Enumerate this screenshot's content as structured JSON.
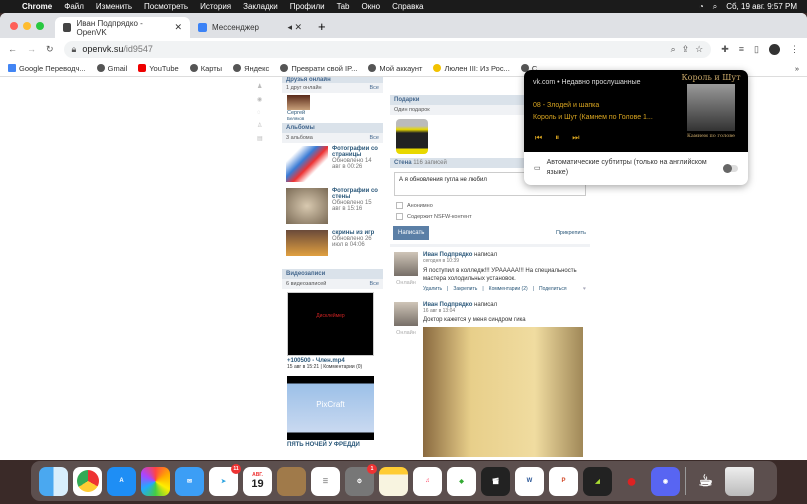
{
  "menubar": {
    "app": "Chrome",
    "items": [
      "Файл",
      "Изменить",
      "Посмотреть",
      "История",
      "Закладки",
      "Профили",
      "Tab",
      "Окно",
      "Справка"
    ],
    "clock": "Сб, 19 авг. 9:57 PM"
  },
  "tabs": [
    {
      "title": "Иван Подпрядко - OpenVK"
    },
    {
      "title": "Мессенджер"
    }
  ],
  "address": {
    "host": "openvk.su",
    "path": "/id9547"
  },
  "bookmarks": [
    "Google Переводч...",
    "Gmail",
    "YouTube",
    "Карты",
    "Яндекс",
    "Преврати свой IP...",
    "Мой аккаунт",
    "Люлен III: Из Рос...",
    "С"
  ],
  "left": {
    "friends_online_header": "Друзья онлайн",
    "friends_online_count": "1 друг онлайн",
    "all": "Все",
    "friend": {
      "first": "Сергей",
      "last": "Беляков"
    },
    "albums_header": "Альбомы",
    "albums_count": "3 альбома",
    "albums": [
      {
        "title": "Фотографии со страницы",
        "updated": "Обновлено 14 авг в 00:26"
      },
      {
        "title": "Фотографии со стены",
        "updated": "Обновлено 15 авг в 15:16"
      },
      {
        "title": "скрины из игр",
        "updated": "Обновлено 26 июл в 04:06"
      }
    ],
    "videos_header": "Видеозаписи",
    "videos_count": "6 видеозаписей",
    "videos": [
      {
        "title": "+100500 - Член.mp4",
        "meta": "15 авг в 15:21 | Комментарии (0)",
        "thumb_text": "Дисклеймер"
      },
      {
        "title": "ПЯТЬ НОЧЕЙ У ФРЕДДИ",
        "thumb_text": "PixCraft"
      }
    ]
  },
  "right": {
    "gifts_header": "Подарки",
    "gifts_count": "Один подарок",
    "wall_header": "Стена",
    "wall_count": "116 записей",
    "wall_input": "А я обновления гугла не любил",
    "anon": "Анонимно",
    "nsfw": "Содержит NSFW-контент",
    "submit": "Написать",
    "attach": "Прикрепить",
    "posts": [
      {
        "author": "Иван Подпрядко",
        "verb": "написал",
        "time": "сегодня в 10:39",
        "text": "Я поступил в колледж!!! УРААААА!!! На специальность мастера холодильных установок.",
        "online": "Онлайн",
        "actions": [
          "Удалить",
          "Закрепить",
          "Комментарии (2)",
          "Поделиться"
        ]
      },
      {
        "author": "Иван Подпрядко",
        "verb": "написал",
        "time": "16 авг в 13:04",
        "text": "Доктор кажется у меня синдром гика",
        "online": "Онлайн"
      }
    ]
  },
  "media": {
    "source": "vk.com",
    "sep": "•",
    "context": "Недавно прослушанные",
    "track": "08 - Злодей и шапка",
    "artist": "Король и Шут (Камнем по Голове 1...",
    "captions": "Автоматические субтитры (только на английском языке)",
    "cover_title": "Король и Шут",
    "cover_sub": "Камнем по голове"
  },
  "dock": {
    "calendar_month": "АВГ.",
    "calendar_day": "19",
    "telegram_badge": "11",
    "settings_badge": "1"
  }
}
